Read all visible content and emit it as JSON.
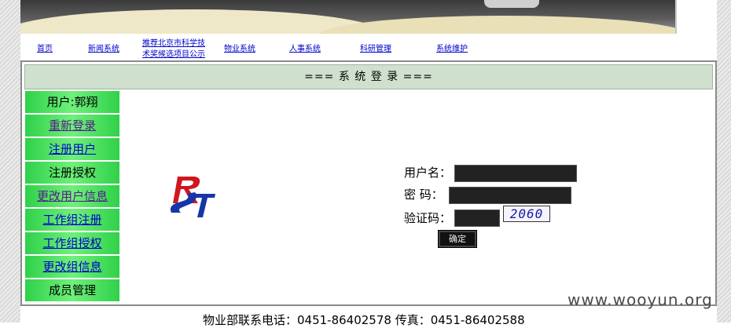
{
  "nav": {
    "items": [
      {
        "label": "首页"
      },
      {
        "label": "新闻系统"
      },
      {
        "label_line1": "推荐北京市科学技",
        "label_line2": "术奖候选项目公示"
      },
      {
        "label": "物业系统"
      },
      {
        "label": "人事系统"
      },
      {
        "label": "科研管理"
      },
      {
        "label": "系统维护"
      }
    ]
  },
  "title_bar": {
    "text": "=== 系 统 登 录 ==="
  },
  "sidebar": {
    "items": [
      {
        "label": "用户:郭翔"
      },
      {
        "label": "重新登录"
      },
      {
        "label": "注册用户"
      },
      {
        "label": "注册授权"
      },
      {
        "label": "更改用户信息"
      },
      {
        "label": "工作组注册"
      },
      {
        "label": "工作组授权"
      },
      {
        "label": "更改组信息"
      },
      {
        "label": "成员管理"
      }
    ]
  },
  "login": {
    "username_label": "用户名：",
    "password_label": "密  码：",
    "captcha_label": "验证码：",
    "captcha_text": "2060",
    "submit_label": "确定"
  },
  "footer": {
    "text": "物业部联系电话：0451-86402578 传真：0451-86402588"
  },
  "watermark": {
    "text": "www.wooyun.org"
  },
  "colors": {
    "menu_green": "#2fd14a",
    "title_bar": "#cfe0cf",
    "link": "#0000cc"
  }
}
